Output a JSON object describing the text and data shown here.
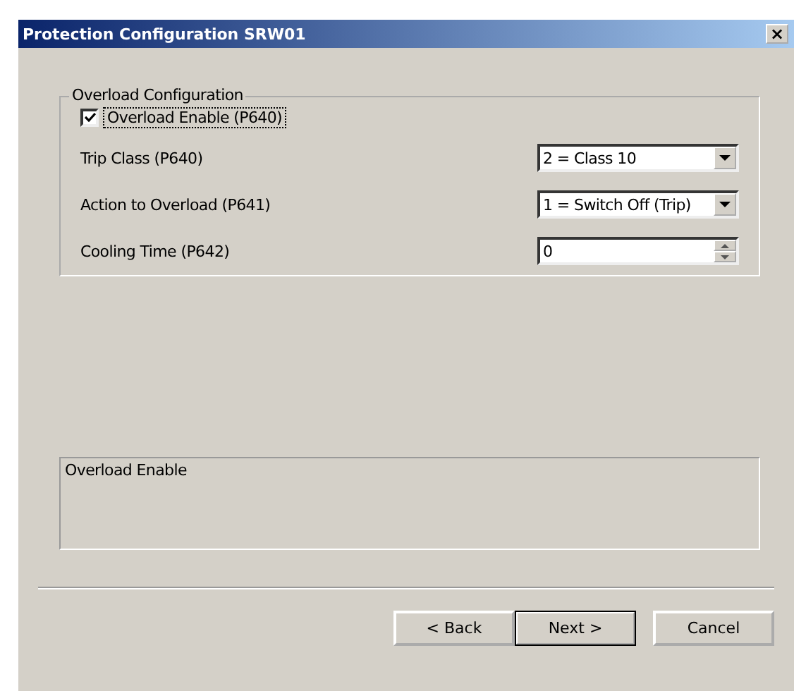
{
  "window": {
    "title": "Protection Configuration SRW01",
    "close": "×"
  },
  "group": {
    "title": "Overload Configuration",
    "enable": {
      "label": "Overload Enable (P640)",
      "checked": true,
      "focused": true
    },
    "fields": [
      {
        "kind": "dropdown",
        "label": "Trip Class (P640)",
        "value": "2 = Class 10"
      },
      {
        "kind": "dropdown",
        "label": "Action to Overload (P641)",
        "value": "1 = Switch Off (Trip)"
      },
      {
        "kind": "spinner",
        "label": "Cooling Time (P642)",
        "value": "0"
      }
    ]
  },
  "description": "Overload Enable",
  "buttons": [
    {
      "label": "< Back",
      "default": false
    },
    {
      "label": "Next >",
      "default": true
    },
    {
      "label": "Cancel",
      "default": false
    }
  ]
}
